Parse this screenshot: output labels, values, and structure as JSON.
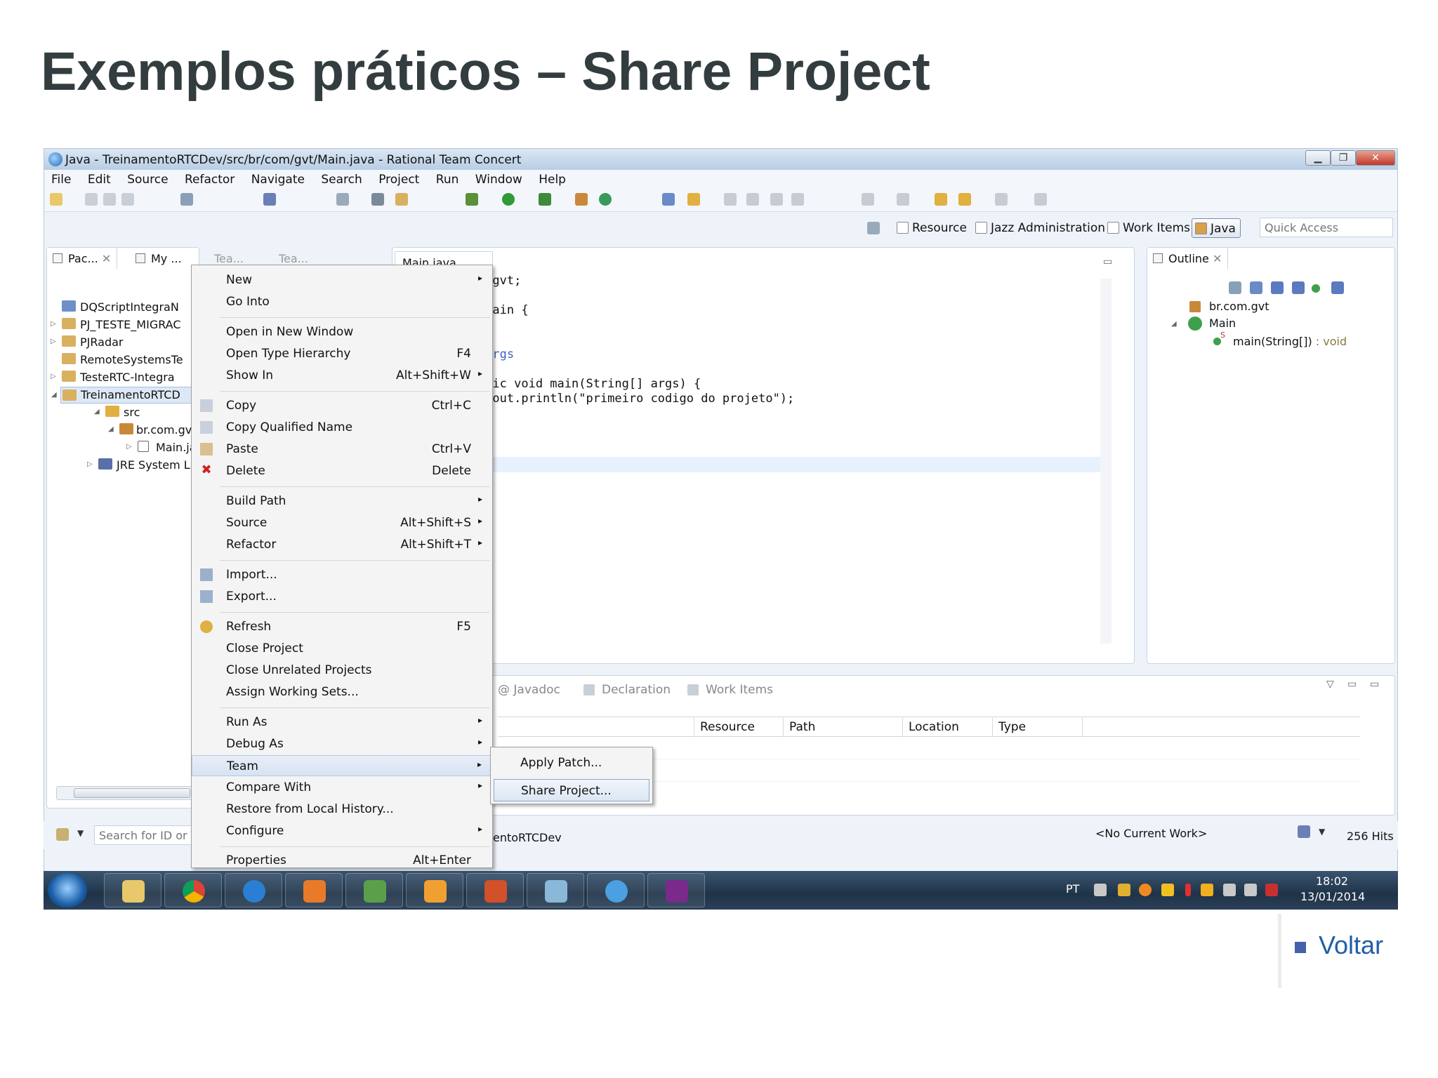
{
  "slide": {
    "title": "Exemplos práticos – Share Project",
    "back_link": "Voltar"
  },
  "window": {
    "title": "Java - TreinamentoRTCDev/src/br/com/gvt/Main.java - Rational Team Concert"
  },
  "menubar": [
    "File",
    "Edit",
    "Source",
    "Refactor",
    "Navigate",
    "Search",
    "Project",
    "Run",
    "Window",
    "Help"
  ],
  "perspectives": [
    "Resource",
    "Jazz Administration",
    "Work Items",
    "Java"
  ],
  "quick_access": "Quick Access",
  "left_tabs": [
    "Pac...",
    "My ...",
    "Tea...",
    "Tea..."
  ],
  "tree": [
    "DQScriptIntegraN",
    "PJ_TESTE_MIGRAC",
    "PJRadar",
    "RemoteSystemsTe",
    "TesteRTC-Integra",
    "TreinamentoRTCD",
    "src",
    "br.com.gvt",
    "Main.ja",
    "JRE System Lib"
  ],
  "editor": {
    "tab": "Main.java",
    "lines": [
      "r.com.gvt;",
      "lass Main {",
      "aram args",
      "c static void main(String[] args) {",
      "ystem.out.println(\"primeiro codigo do projeto\");"
    ]
  },
  "outline": {
    "tab": "Outline",
    "items": [
      "br.com.gvt",
      "Main",
      "main(String[])",
      ": void"
    ],
    "static_mark": "S"
  },
  "context_menu": [
    {
      "label": "New",
      "shortcut": "",
      "arrow": "▸"
    },
    {
      "label": "Go Into",
      "shortcut": "",
      "arrow": ""
    },
    {
      "label": "Open in New Window",
      "shortcut": "",
      "arrow": ""
    },
    {
      "label": "Open Type Hierarchy",
      "shortcut": "F4",
      "arrow": ""
    },
    {
      "label": "Show In",
      "shortcut": "Alt+Shift+W",
      "arrow": "▸"
    },
    {
      "label": "Copy",
      "shortcut": "Ctrl+C",
      "arrow": ""
    },
    {
      "label": "Copy Qualified Name",
      "shortcut": "",
      "arrow": ""
    },
    {
      "label": "Paste",
      "shortcut": "Ctrl+V",
      "arrow": ""
    },
    {
      "label": "Delete",
      "shortcut": "Delete",
      "arrow": ""
    },
    {
      "label": "Build Path",
      "shortcut": "",
      "arrow": "▸"
    },
    {
      "label": "Source",
      "shortcut": "Alt+Shift+S",
      "arrow": "▸"
    },
    {
      "label": "Refactor",
      "shortcut": "Alt+Shift+T",
      "arrow": "▸"
    },
    {
      "label": "Import...",
      "shortcut": "",
      "arrow": ""
    },
    {
      "label": "Export...",
      "shortcut": "",
      "arrow": ""
    },
    {
      "label": "Refresh",
      "shortcut": "F5",
      "arrow": ""
    },
    {
      "label": "Close Project",
      "shortcut": "",
      "arrow": ""
    },
    {
      "label": "Close Unrelated Projects",
      "shortcut": "",
      "arrow": ""
    },
    {
      "label": "Assign Working Sets...",
      "shortcut": "",
      "arrow": ""
    },
    {
      "label": "Run As",
      "shortcut": "",
      "arrow": "▸"
    },
    {
      "label": "Debug As",
      "shortcut": "",
      "arrow": "▸"
    },
    {
      "label": "Team",
      "shortcut": "",
      "arrow": "▸"
    },
    {
      "label": "Compare With",
      "shortcut": "",
      "arrow": "▸"
    },
    {
      "label": "Restore from Local History...",
      "shortcut": "",
      "arrow": ""
    },
    {
      "label": "Configure",
      "shortcut": "",
      "arrow": "▸"
    },
    {
      "label": "Properties",
      "shortcut": "Alt+Enter",
      "arrow": ""
    }
  ],
  "team_submenu": [
    "Apply Patch...",
    "Share Project..."
  ],
  "bottom_tabs": [
    "@ Javadoc",
    "Declaration",
    "Work Items"
  ],
  "problems_columns": [
    "Resource",
    "Path",
    "Location",
    "Type"
  ],
  "status": {
    "search_placeholder": "Search for ID or Te",
    "project": "entoRTCDev",
    "current_work": "<No Current Work>",
    "hits": "256 Hits"
  },
  "taskbar": {
    "lang": "PT",
    "time": "18:02",
    "date": "13/01/2014"
  },
  "colors": {
    "title": "#333d40",
    "link": "#1f5ea8",
    "bullet": "#4460ac"
  }
}
